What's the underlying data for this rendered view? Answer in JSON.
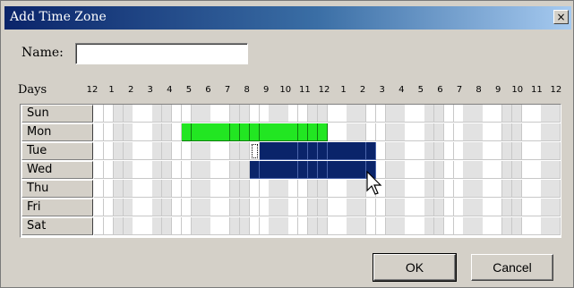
{
  "window": {
    "title": "Add Time Zone",
    "close_glyph": "×"
  },
  "name": {
    "label": "Name:",
    "value": ""
  },
  "schedule": {
    "days_label": "Days",
    "hour_labels": [
      "12",
      "1",
      "2",
      "3",
      "4",
      "5",
      "6",
      "7",
      "8",
      "9",
      "10",
      "11",
      "12",
      "1",
      "2",
      "3",
      "4",
      "5",
      "6",
      "7",
      "8",
      "9",
      "10",
      "11",
      "12"
    ],
    "days": [
      "Sun",
      "Mon",
      "Tue",
      "Wed",
      "Thu",
      "Fri",
      "Sat"
    ],
    "selections": [
      {
        "day": "Mon",
        "color": "green",
        "from_hour": 4.5,
        "to_hour": 12
      },
      {
        "day": "Tue",
        "color": "blue",
        "from_hour": 8,
        "to_hour": 14.5
      },
      {
        "day": "Wed",
        "color": "blue",
        "from_hour": 8,
        "to_hour": 14.5
      }
    ],
    "focused_slot": {
      "day": "Tue",
      "hour": 8
    },
    "colors": {
      "green": "#22e622",
      "blue": "#0a246a",
      "alt": "#e2e2e2"
    }
  },
  "buttons": {
    "ok": "OK",
    "cancel": "Cancel"
  }
}
